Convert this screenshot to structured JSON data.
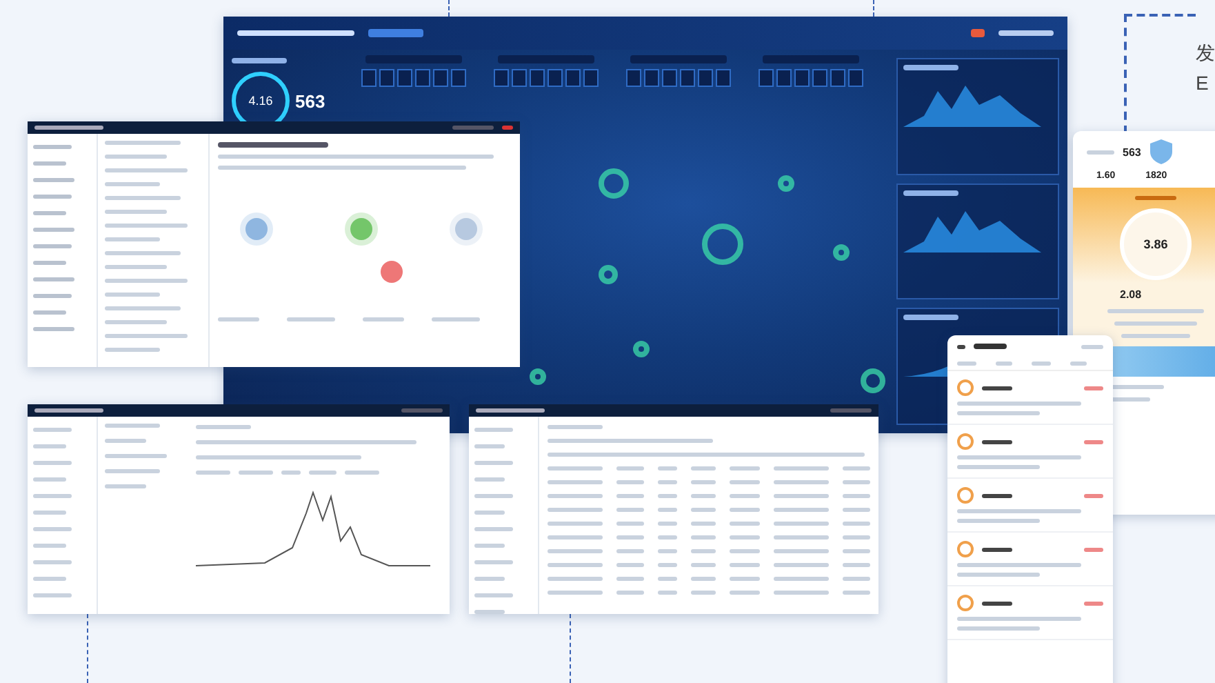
{
  "edge_text": [
    "发",
    "E"
  ],
  "dashboard": {
    "gauge_value": "4.16",
    "count": "563"
  },
  "profile_card": {
    "count": "563",
    "stats": [
      "1.60",
      "1820"
    ],
    "score": "3.86",
    "figure": "2.08"
  }
}
